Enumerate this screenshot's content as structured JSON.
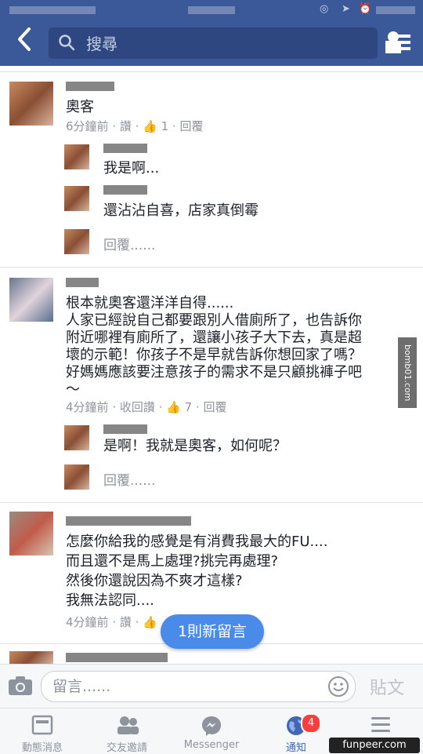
{
  "search": {
    "placeholder": "搜尋"
  },
  "comments": [
    {
      "text": "奧客",
      "time": "6分鐘前",
      "like": "讚",
      "like_count": "1",
      "reply": "回覆",
      "replies": [
        {
          "text": "我是啊..."
        },
        {
          "text": "還沾沾自喜，店家真倒霉"
        }
      ],
      "reply_placeholder": "回覆......"
    },
    {
      "text_lines": [
        "根本就奧客還洋洋自得......",
        "人家已經說自己都要跟別人借廁所了，也告訴你",
        "附近哪裡有廁所了，還讓小孩子大下去，真是超",
        "壞的示範！你孩子不是早就告訴你想回家了嗎？",
        "好媽媽應該要注意孩子的需求不是只顧挑褲子吧",
        "～"
      ],
      "time": "4分鐘前",
      "like": "收回讚",
      "like_count": "7",
      "reply": "回覆",
      "replies": [
        {
          "text": "是啊！我就是奧客，如何呢？"
        }
      ],
      "reply_placeholder": "回覆......"
    },
    {
      "text_lines": [
        "怎麼你給我的感覺是有消費我最大的FU....",
        "而且還不是馬上處理?挑完再處理?",
        "然後你還說因為不爽才這樣?",
        "我無法認同...."
      ],
      "time": "4分鐘前",
      "like": "讚"
    }
  ],
  "new_comments_pill": "1則新留言",
  "composer": {
    "placeholder": "留言......",
    "post_label": "貼文"
  },
  "watermark": "bomb01.com",
  "tabs": [
    {
      "label": "動態消息",
      "icon": "news-feed-icon"
    },
    {
      "label": "交友邀請",
      "icon": "friend-requests-icon"
    },
    {
      "label": "Messenger",
      "icon": "messenger-icon"
    },
    {
      "label": "通知",
      "icon": "globe-icon",
      "badge": "4"
    },
    {
      "label": "",
      "icon": "menu-icon"
    }
  ],
  "colors": {
    "brand": "#3b5998",
    "link": "#4267b2",
    "badge": "#fa3e3e",
    "pill": "#4a8ae8"
  },
  "corner_watermark": "funpeer.com"
}
